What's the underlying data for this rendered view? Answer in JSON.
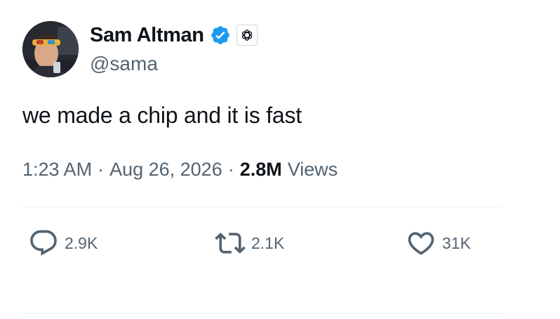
{
  "author": {
    "display_name": "Sam Altman",
    "handle": "@sama",
    "verified_icon": "verified-badge-icon",
    "affiliate_icon": "openai-logo-icon"
  },
  "tweet": {
    "text": "we made a chip and it is fast"
  },
  "meta": {
    "time": "1:23 AM",
    "sep1": "·",
    "date": "Aug 26, 2026",
    "sep2": "·",
    "views_count": "2.8M",
    "views_label": "Views"
  },
  "actions": {
    "replies": "2.9K",
    "retweets": "2.1K",
    "likes": "31K"
  },
  "colors": {
    "primary_text": "#0f1419",
    "secondary_text": "#536471",
    "verified_blue": "#1d9bf0",
    "divider": "#eff3f4"
  }
}
